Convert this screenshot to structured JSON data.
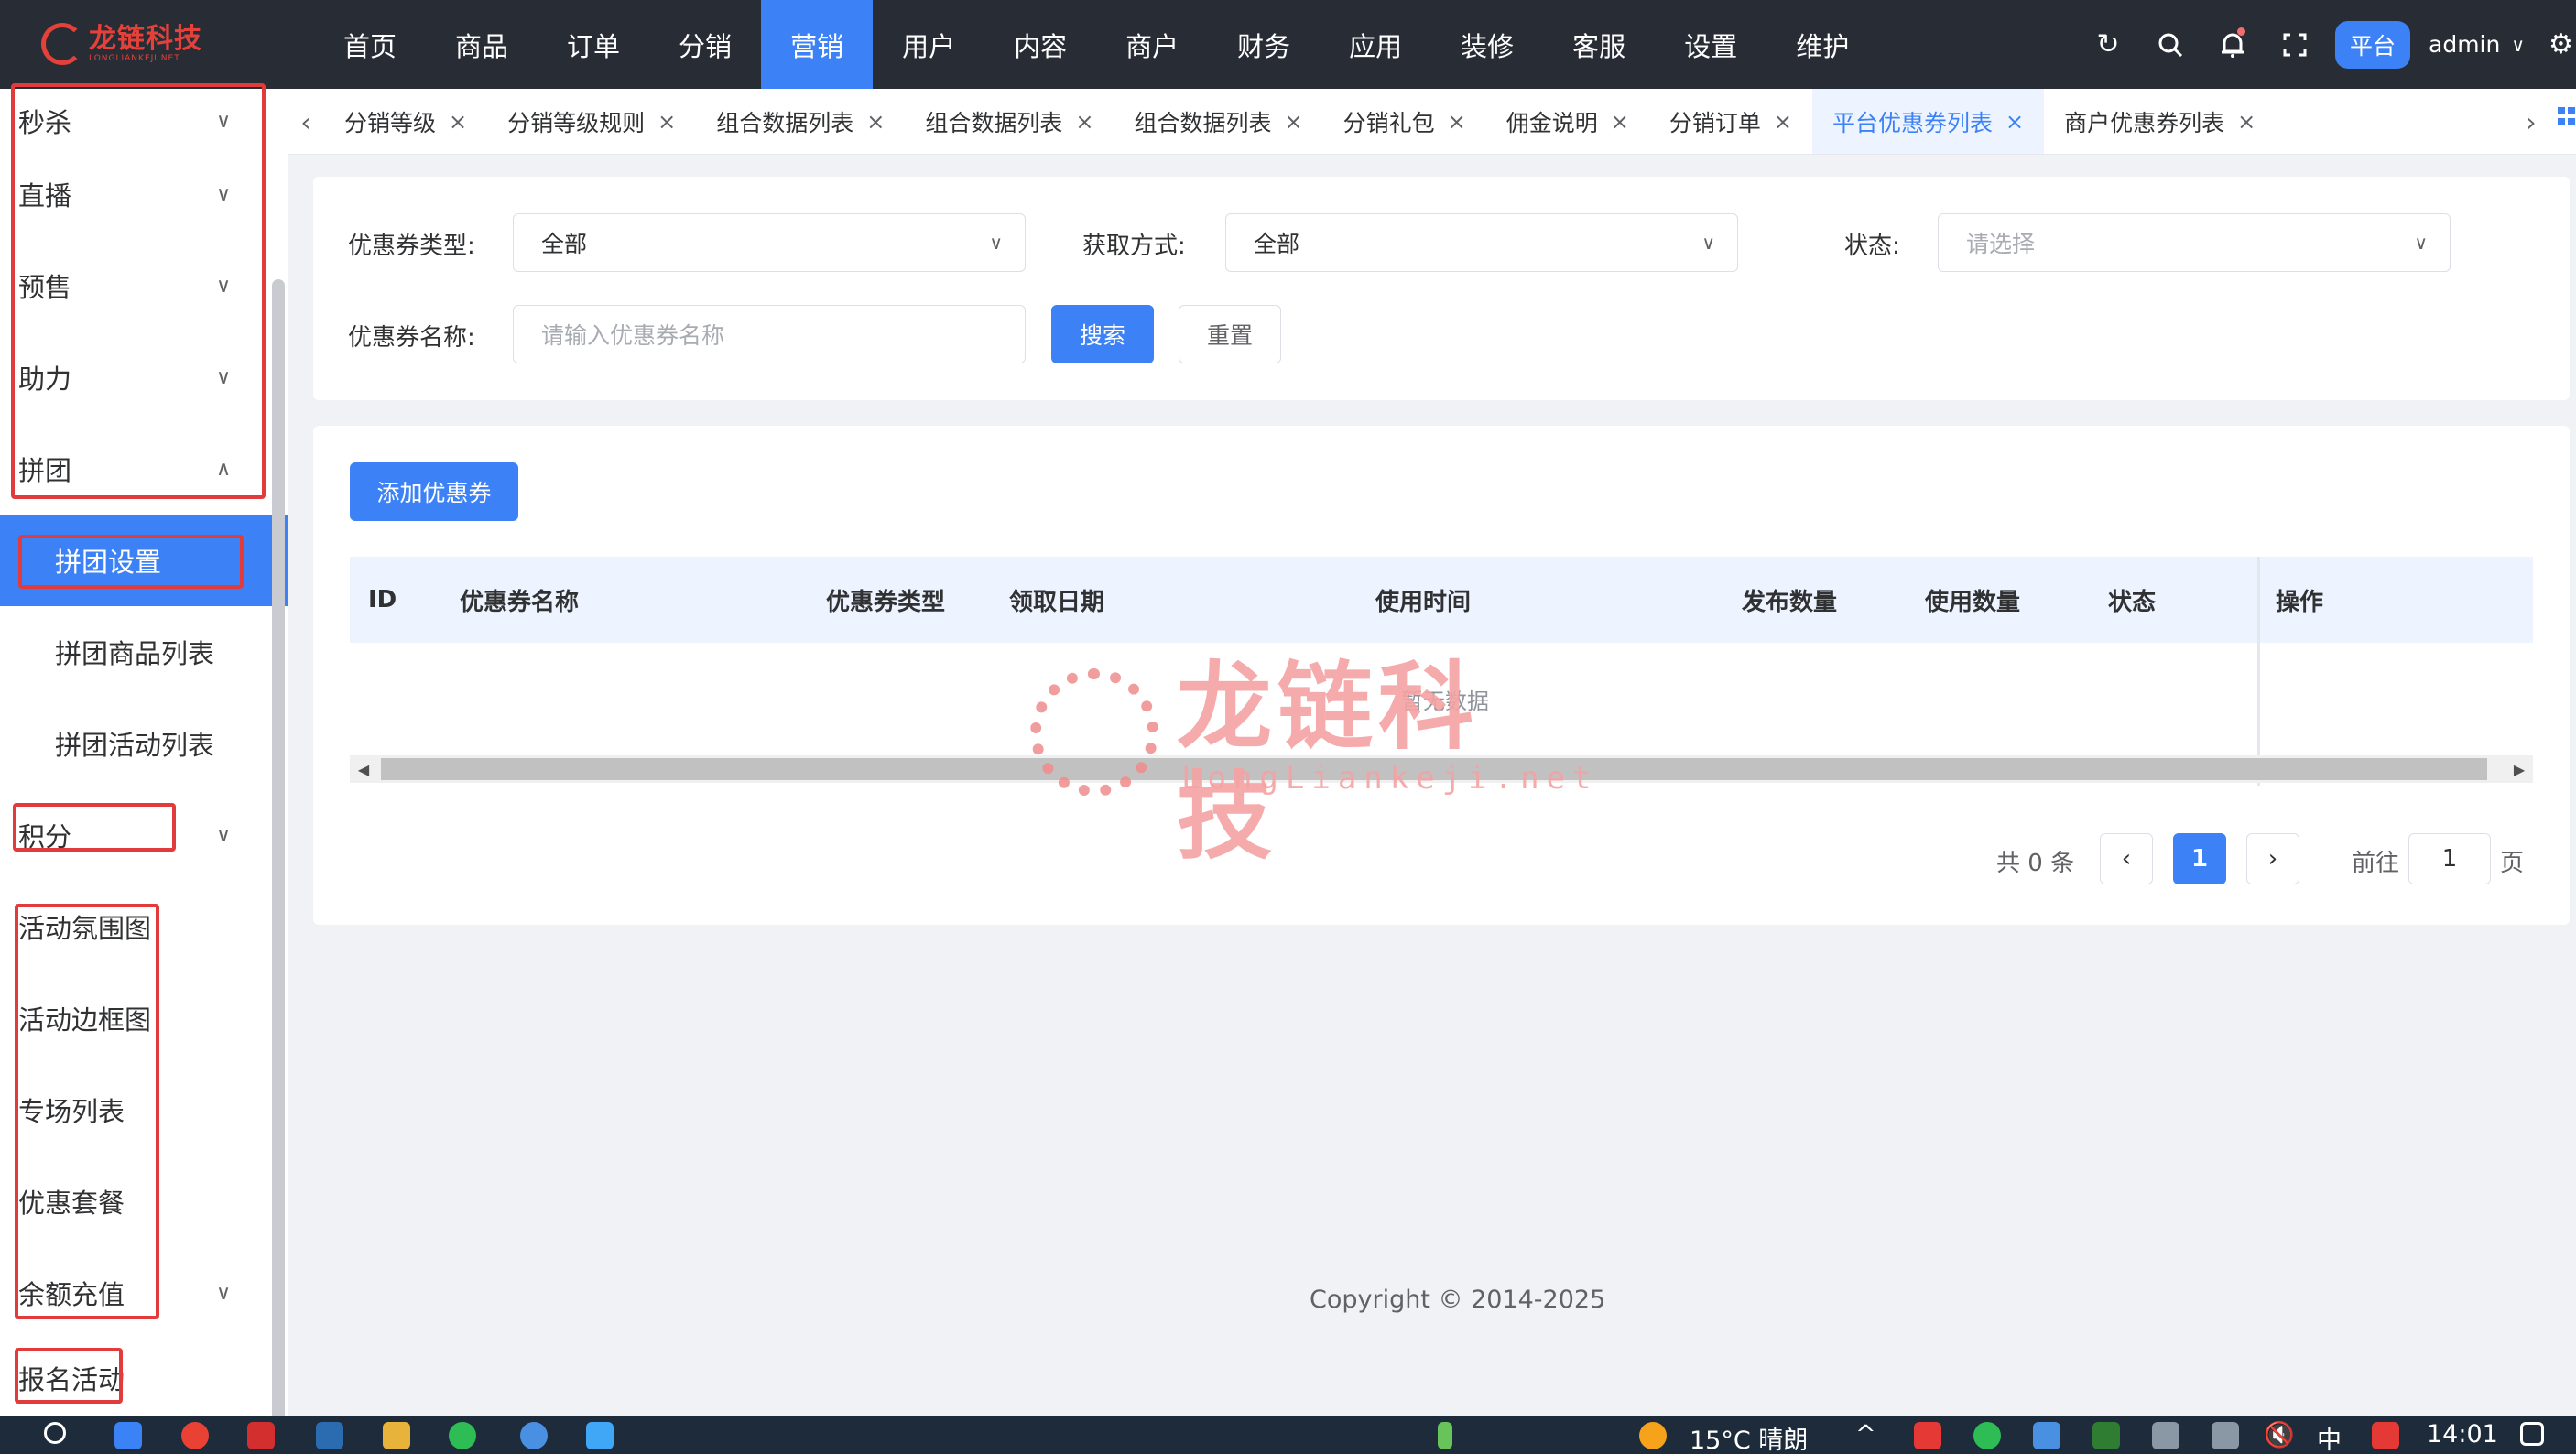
{
  "logo": {
    "cn": "龙链科技",
    "en": "LONGLIANKEJI.NET"
  },
  "nav": [
    "首页",
    "商品",
    "订单",
    "分销",
    "营销",
    "用户",
    "内容",
    "商户",
    "财务",
    "应用",
    "装修",
    "客服",
    "设置",
    "维护"
  ],
  "nav_active_index": 4,
  "topbar": {
    "platform": "平台",
    "user": "admin"
  },
  "sidebar": {
    "groups": [
      "秒杀",
      "直播",
      "预售",
      "助力",
      "拼团"
    ],
    "pintuan_sub": [
      "拼团设置",
      "拼团商品列表",
      "拼团活动列表"
    ],
    "points": "积分",
    "flat_items": [
      "活动氛围图",
      "活动边框图",
      "专场列表",
      "优惠套餐"
    ],
    "recharge": "余额充值",
    "signup": "报名活动"
  },
  "tabs": [
    "分销等级",
    "分销等级规则",
    "组合数据列表",
    "组合数据列表",
    "组合数据列表",
    "分销礼包",
    "佣金说明",
    "分销订单",
    "平台优惠券列表",
    "商户优惠券列表"
  ],
  "tab_active_index": 8,
  "filters": {
    "type_label": "优惠券类型:",
    "type_value": "全部",
    "method_label": "获取方式:",
    "method_value": "全部",
    "status_label": "状态:",
    "status_placeholder": "请选择",
    "name_label": "优惠券名称:",
    "name_placeholder": "请输入优惠券名称",
    "search": "搜索",
    "reset": "重置"
  },
  "add_coupon": "添加优惠券",
  "table": {
    "columns": [
      "ID",
      "优惠券名称",
      "优惠券类型",
      "领取日期",
      "使用时间",
      "发布数量",
      "使用数量",
      "状态",
      "操作"
    ],
    "empty": "暂无数据"
  },
  "pagination": {
    "total": "共 0 条",
    "current": "1",
    "goto": "前往",
    "goto_value": "1",
    "page_unit": "页"
  },
  "watermark": {
    "cn": "龙链科技",
    "en": "LongLiankeji.net"
  },
  "copyright": "Copyright © 2014-2025",
  "taskbar": {
    "weather": "15°C 晴朗",
    "ime": "中",
    "time": "14:01"
  },
  "colors": {
    "accent": "#3c82f6",
    "topbar": "#282c34",
    "highlight_box": "#e23b3b"
  }
}
